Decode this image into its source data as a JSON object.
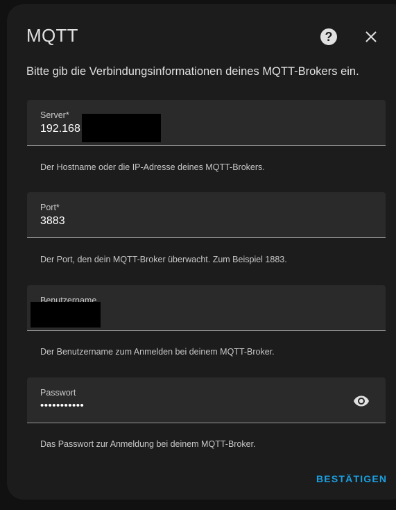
{
  "dialog": {
    "title": "MQTT",
    "subtitle": "Bitte gib die Verbindungsinformationen deines MQTT-Brokers ein.",
    "help_icon": "help-circle-icon",
    "close_icon": "close-icon"
  },
  "fields": {
    "server": {
      "label": "Server*",
      "value": "192.168",
      "helper": "Der Hostname oder die IP-Adresse deines MQTT-Brokers."
    },
    "port": {
      "label": "Port*",
      "value": "3883",
      "helper": "Der Port, den dein MQTT-Broker überwacht. Zum Beispiel 1883."
    },
    "username": {
      "label": "Benutzername",
      "value": "",
      "helper": "Der Benutzername zum Anmelden bei deinem MQTT-Broker."
    },
    "password": {
      "label": "Passwort",
      "value": "•••••••••••",
      "helper": "Das Passwort zur Anmeldung bei deinem MQTT-Broker.",
      "toggle_icon": "eye-icon"
    }
  },
  "actions": {
    "confirm_label": "BESTÄTIGEN"
  },
  "colors": {
    "accent": "#1ba0e2",
    "dialog_background": "#1c1c1c",
    "field_background": "#2a2a2a"
  }
}
